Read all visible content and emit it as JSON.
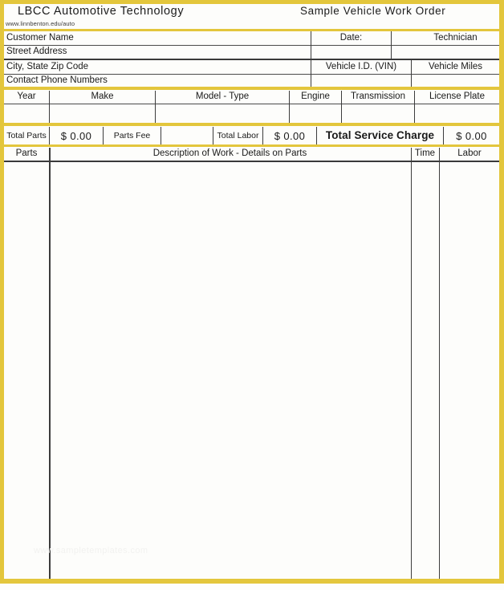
{
  "document": {
    "org_title": "LBCC  Automotive  Technology",
    "org_url": "www.linnbenton.edu/auto",
    "doc_title": "Sample  Vehicle  Work  Order",
    "accent_color": "#e3c63c",
    "rule_color": "#3c3c3c",
    "paper_color": "#fdfdfb",
    "watermark": "www.sampletemplates.com"
  },
  "customer_block": {
    "rows": [
      {
        "label": "Customer Name",
        "value": ""
      },
      {
        "label": "Street Address",
        "value": ""
      },
      {
        "label": "City, State    Zip Code",
        "value": ""
      },
      {
        "label": "Contact Phone Numbers",
        "value": ""
      }
    ],
    "date_label": "Date:",
    "date_value": "",
    "technician_label": "Technician",
    "technician_value": "",
    "vin_label": "Vehicle I.D. (VIN)",
    "vin_value": "",
    "miles_label": "Vehicle Miles",
    "miles_value": ""
  },
  "vehicle_block": {
    "headers": [
      "Year",
      "Make",
      "Model  - Type",
      "Engine",
      "Transmission",
      "License Plate"
    ],
    "values": [
      "",
      "",
      "",
      "",
      "",
      ""
    ]
  },
  "totals_block": {
    "total_parts_label": "Total Parts",
    "total_parts_value": "$  0.00",
    "parts_fee_label": "Parts Fee",
    "parts_fee_value": "",
    "total_labor_label": "Total Labor",
    "total_labor_value": "$  0.00",
    "total_service_charge_label": "Total Service Charge",
    "total_service_charge_value": "$  0.00"
  },
  "work_table": {
    "headers": {
      "parts": "Parts",
      "description": "Description of Work - Details on Parts",
      "time": "Time",
      "labor": "Labor"
    },
    "rows": []
  }
}
